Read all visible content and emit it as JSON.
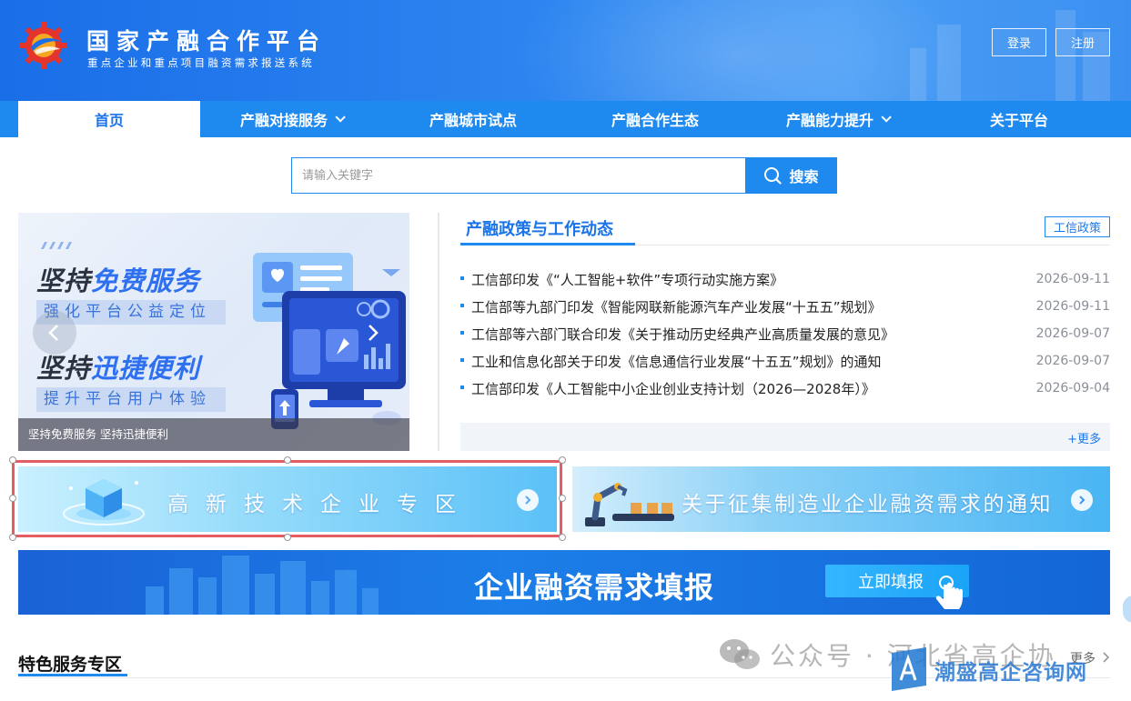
{
  "header": {
    "title": "国家产融合作平台",
    "subtitle": "重点企业和重点项目融资需求报送系统",
    "login": "登录",
    "register": "注册"
  },
  "nav": {
    "items": [
      {
        "label": "首页",
        "active": true,
        "dropdown": false
      },
      {
        "label": "产融对接服务",
        "active": false,
        "dropdown": true
      },
      {
        "label": "产融城市试点",
        "active": false,
        "dropdown": false
      },
      {
        "label": "产融合作生态",
        "active": false,
        "dropdown": false
      },
      {
        "label": "产融能力提升",
        "active": false,
        "dropdown": true
      },
      {
        "label": "关于平台",
        "active": false,
        "dropdown": false
      }
    ]
  },
  "search": {
    "placeholder": "请输入关键字",
    "button": "搜索"
  },
  "carousel": {
    "line1_prefix": "坚持",
    "line1_highlight": "免费服务",
    "tag1": "强化平台公益定位",
    "line2_prefix": "坚持",
    "line2_highlight": "迅捷便利",
    "tag2": "提升平台用户体验",
    "caption": "坚持免费服务 坚持迅捷便利"
  },
  "news": {
    "title": "产融政策与工作动态",
    "tag": "工信政策",
    "more": "+更多",
    "items": [
      {
        "title": "工信部印发《“人工智能+软件”专项行动实施方案》",
        "date": "2026-09-11"
      },
      {
        "title": "工信部等九部门印发《智能网联新能源汽车产业发展“十五五”规划》",
        "date": "2026-09-11"
      },
      {
        "title": "工信部等六部门联合印发《关于推动历史经典产业高质量发展的意见》",
        "date": "2026-09-07"
      },
      {
        "title": "工业和信息化部关于印发《信息通信行业发展“十五五”规划》的通知",
        "date": "2026-09-07"
      },
      {
        "title": "工信部印发《人工智能中小企业创业支持计划（2026—2028年）》",
        "date": "2026-09-04"
      }
    ]
  },
  "banners": {
    "hitech": "高新技术企业专区",
    "notice": "关于征集制造业企业融资需求的通知",
    "fill_title": "企业融资需求填报",
    "fill_button": "立即填报"
  },
  "section": {
    "title": "特色服务专区",
    "more": "更多"
  },
  "watermark": {
    "wechat_text": "公众号 · 河北省高企协",
    "brand_text": "潮盛高企咨询网"
  },
  "colors": {
    "primary": "#1e8af0",
    "nav_active_text": "#1a74e8",
    "selection_frame": "#e35d62"
  }
}
